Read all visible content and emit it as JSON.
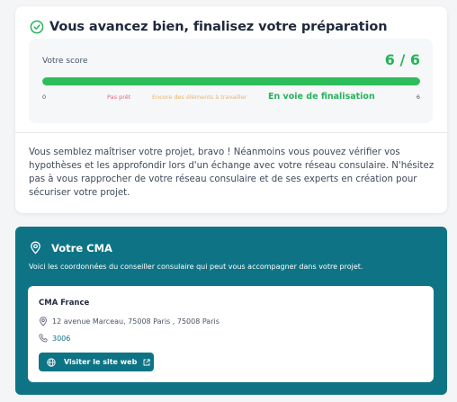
{
  "progress": {
    "title": "Vous avancez bien, finalisez votre préparation",
    "score_label": "Votre score",
    "score_value": "6 / 6",
    "score_fraction": 1.0,
    "scale_min": "0",
    "scale_max": "6",
    "level_low": "Pas prêt",
    "level_mid": "Encore des éléments à travailler",
    "level_high": "En voie de finalisation",
    "message": "Vous semblez maîtriser votre projet, bravo ! Néanmoins vous pouvez vérifier vos hypothèses et les approfondir lors d'un échange avec votre réseau consulaire. N'hésitez pas à vous rapprocher de votre réseau consulaire et de ses experts en création pour sécuriser votre projet."
  },
  "cma": {
    "title": "Votre CMA",
    "description": "Voici les coordonnées du conseiller consulaire qui peut vous accompagner dans votre projet.",
    "contact": {
      "name": "CMA France",
      "address": "12 avenue Marceau, 75008 Paris , 75008 Paris",
      "phone": "3006",
      "visit_label": "Visiter le site web"
    }
  },
  "icons": {
    "check": "check-circle-icon",
    "pin": "map-pin-icon",
    "address": "map-pin-icon",
    "phone": "phone-icon",
    "globe": "globe-icon",
    "external": "external-link-icon"
  },
  "colors": {
    "success": "#27b35a",
    "teal": "#0e7485",
    "low": "#e06a7a",
    "mid": "#e8b56a"
  }
}
